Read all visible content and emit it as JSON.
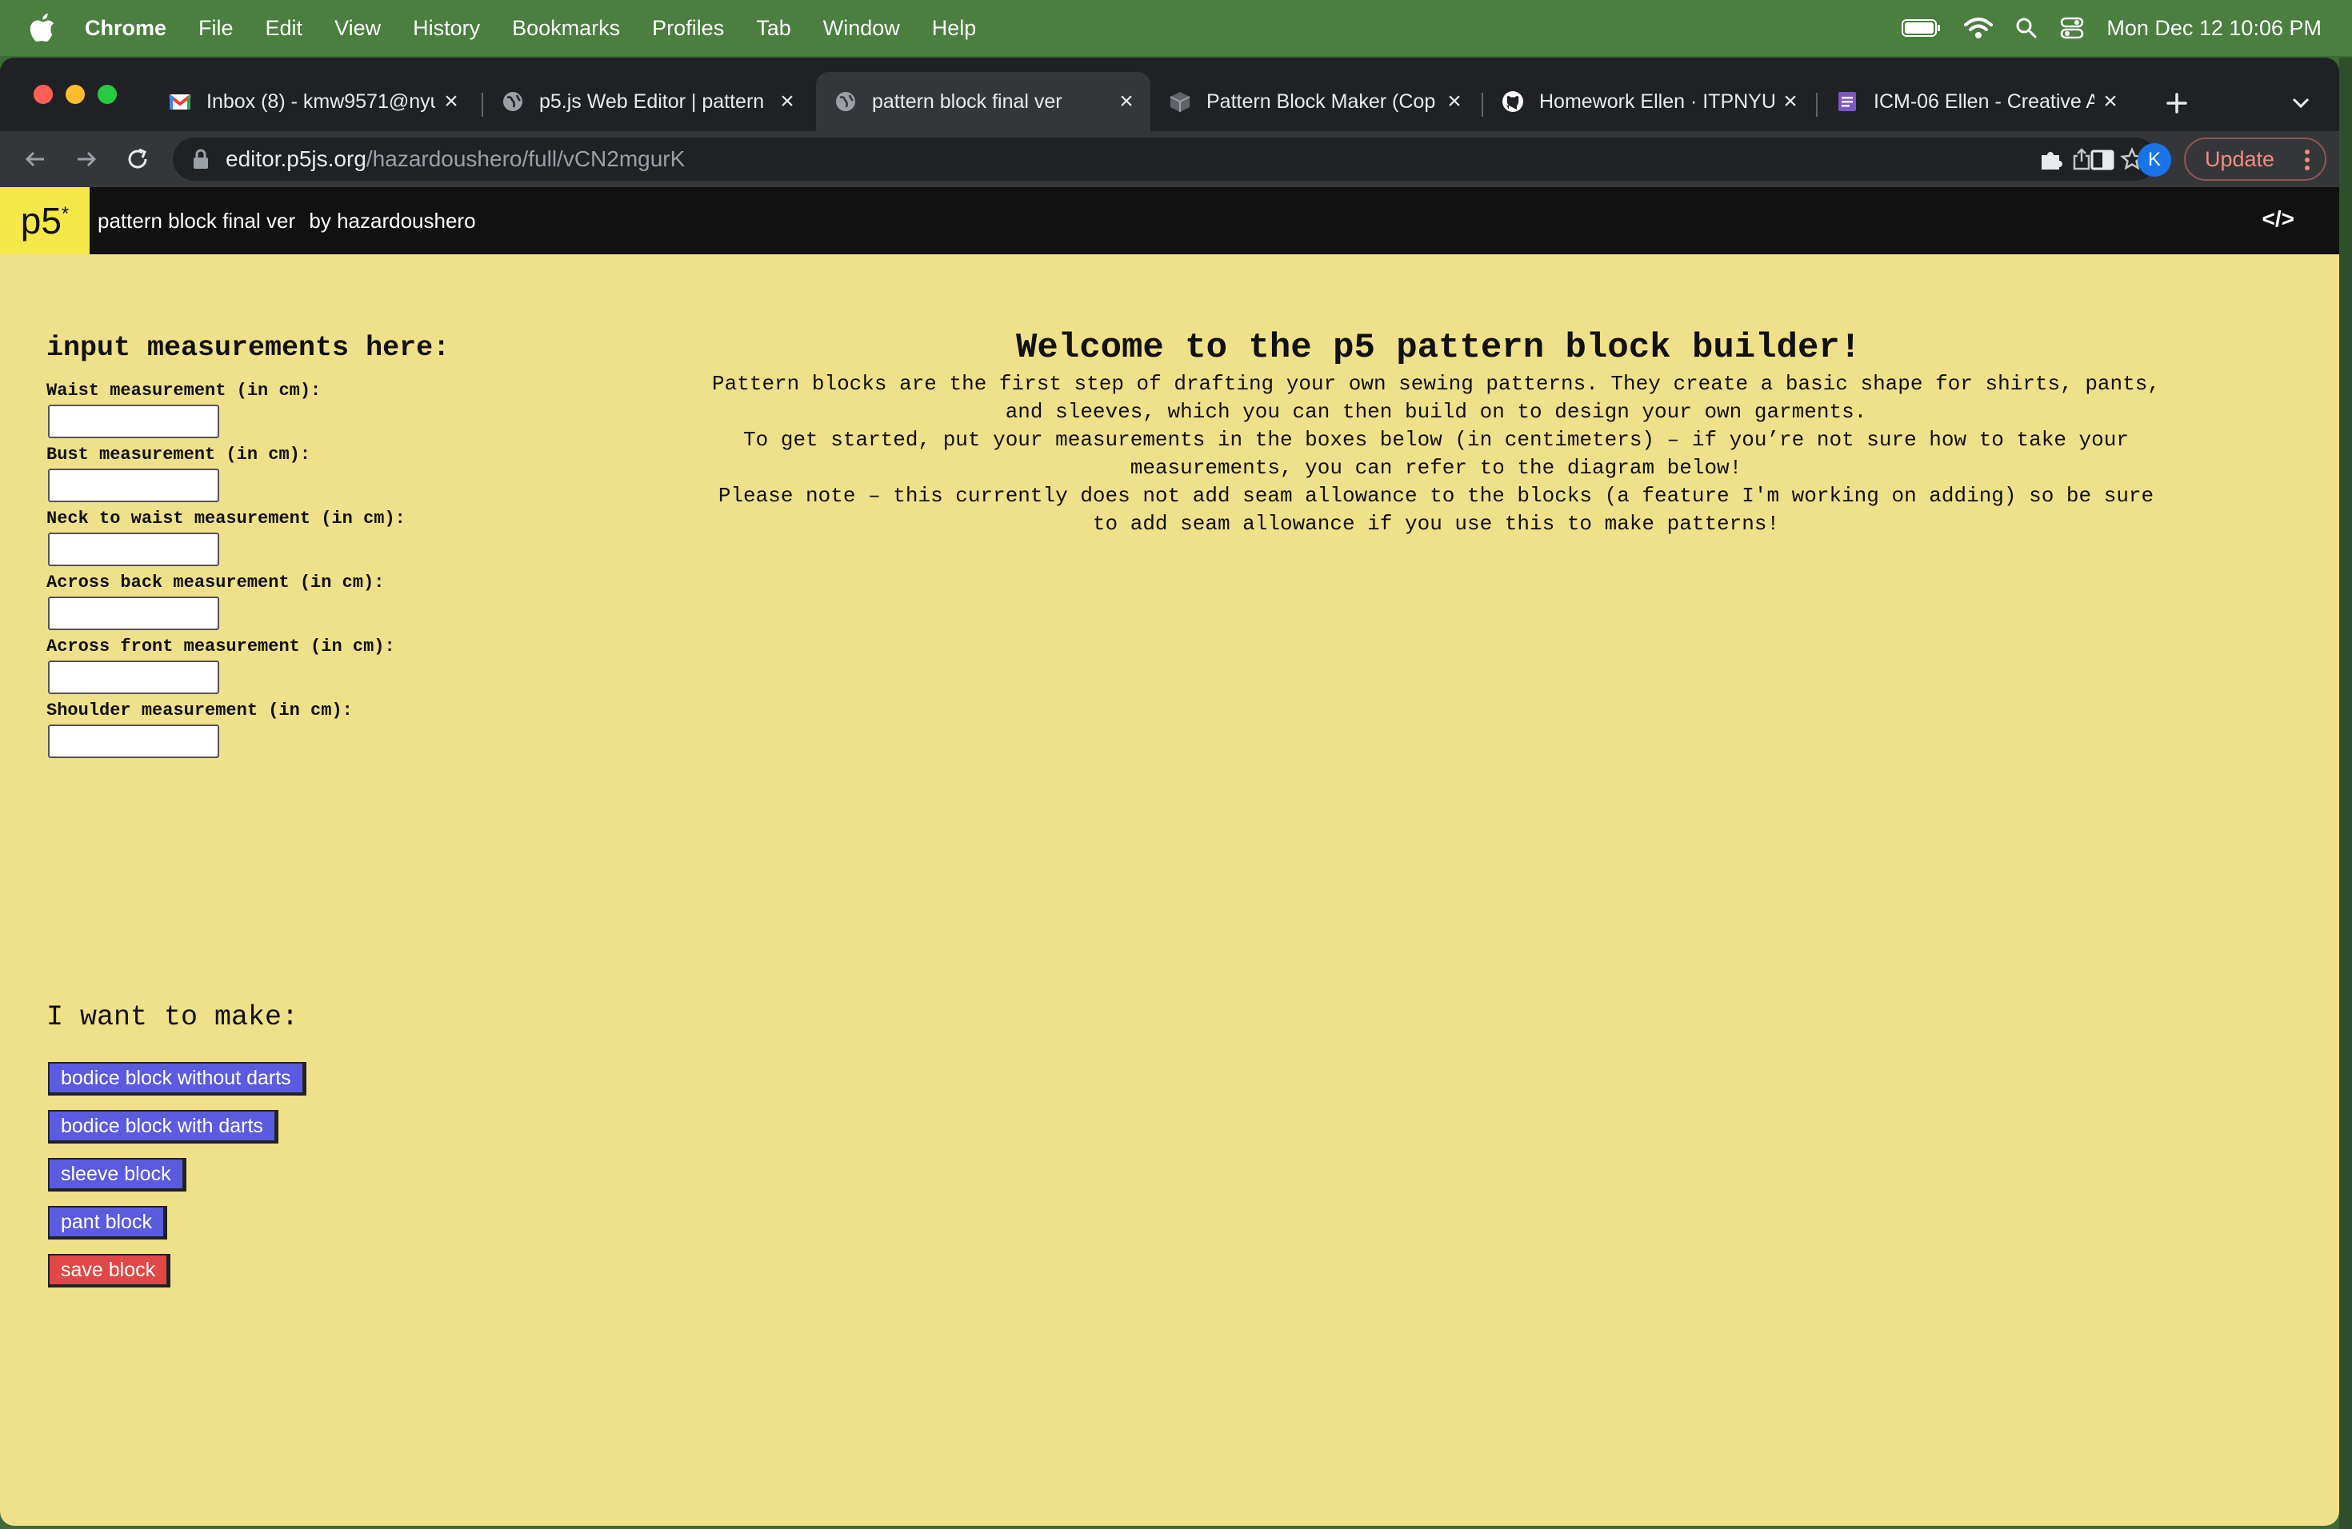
{
  "menubar": {
    "app": "Chrome",
    "items": [
      "File",
      "Edit",
      "View",
      "History",
      "Bookmarks",
      "Profiles",
      "Tab",
      "Window",
      "Help"
    ],
    "clock": "Mon Dec 12  10:06 PM"
  },
  "tabs": [
    {
      "title": "Inbox (8) - kmw9571@nyu",
      "icon": "gmail-icon"
    },
    {
      "title": "p5.js Web Editor | pattern",
      "icon": "globe-icon"
    },
    {
      "title": "pattern block final ver",
      "icon": "globe-icon"
    },
    {
      "title": "Pattern Block Maker (Cop",
      "icon": "box-icon"
    },
    {
      "title": "Homework Ellen · ITPNYU",
      "icon": "github-icon"
    },
    {
      "title": "ICM-06 Ellen - Creative A",
      "icon": "doc-icon"
    }
  ],
  "address": {
    "host": "editor.p5js.org",
    "path": "/hazardoushero/full/vCN2mgurK"
  },
  "toolbar": {
    "avatar_letter": "K",
    "update_label": "Update"
  },
  "p5": {
    "logo": "p5",
    "logo_sup": "*",
    "sketch_title": "pattern block final ver",
    "by": "by",
    "author": "hazardoushero",
    "code_icon": "</>"
  },
  "sketch": {
    "inputs_heading": "input measurements here:",
    "fields": [
      {
        "label": "Waist measurement (in cm):",
        "value": ""
      },
      {
        "label": "Bust measurement (in cm):",
        "value": ""
      },
      {
        "label": "Neck to waist measurement (in cm):",
        "value": ""
      },
      {
        "label": "Across back measurement (in cm):",
        "value": ""
      },
      {
        "label": "Across front measurement (in cm):",
        "value": ""
      },
      {
        "label": "Shoulder measurement (in cm):",
        "value": ""
      }
    ],
    "welcome_title": "Welcome to the p5 pattern block builder!",
    "welcome_lines": [
      "Pattern blocks are the first step of drafting your own sewing patterns. They create a basic shape for shirts, pants,",
      "and sleeves, which you can then build on to design your own garments.",
      "To get started, put your measurements in the boxes below (in centimeters) – if you’re not sure how to take your",
      "measurements, you can refer to the diagram below!",
      "Please note – this currently does not add seam allowance to the blocks (a feature I'm working on adding) so be sure",
      "to add seam allowance if you use this to make patterns!"
    ],
    "make_heading": "I want to make:",
    "buttons": [
      {
        "label": "bodice block without darts"
      },
      {
        "label": "bodice block with darts"
      },
      {
        "label": "sleeve block"
      },
      {
        "label": "pant block"
      },
      {
        "label": "save block"
      }
    ]
  },
  "colors": {
    "canvas_bg": "#efe08a",
    "button_blue": "#5a5ce0",
    "button_red": "#e04848",
    "menubar_green": "#4a7f3f"
  }
}
